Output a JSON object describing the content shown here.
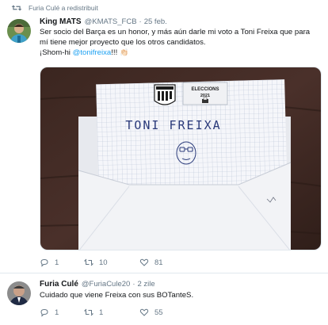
{
  "retweet_context": {
    "text": "Furia Culé a redistribuit",
    "icon": "retweet-icon"
  },
  "tweets": [
    {
      "author": {
        "name": "King MATS",
        "handle": "@KMATS_FCB",
        "time": "25 feb."
      },
      "lines": [
        "Ser socio del Barça es un honor, y más aún darle mi voto a Toni Freixa que para",
        "mí tiene mejor proyecto que los otros candidatos."
      ],
      "last_line": {
        "prefix": "¡Shom-hi ",
        "mention": "@tonifreixa",
        "suffix": "!!! ",
        "emoji": "👏🏻"
      },
      "media": {
        "envelope_text": "TONI FREIXA",
        "ballot_header": "ELECCIONS",
        "ballot_year": "2021",
        "crest_text": "FCB"
      },
      "actions": {
        "replies": "1",
        "retweets": "10",
        "likes": "81"
      }
    },
    {
      "author": {
        "name": "Furia Culé",
        "handle": "@FuriaCule20",
        "time": "2 zile"
      },
      "lines": [
        "Cuidado que viene Freixa con sus BOTanteS."
      ],
      "actions": {
        "replies": "1",
        "retweets": "1",
        "likes": "55"
      }
    }
  ],
  "icons": {
    "reply": "reply-icon",
    "retweet": "retweet-icon",
    "like": "heart-icon"
  },
  "colors": {
    "link": "#1da1f2",
    "muted": "#657786",
    "text": "#14171a"
  }
}
